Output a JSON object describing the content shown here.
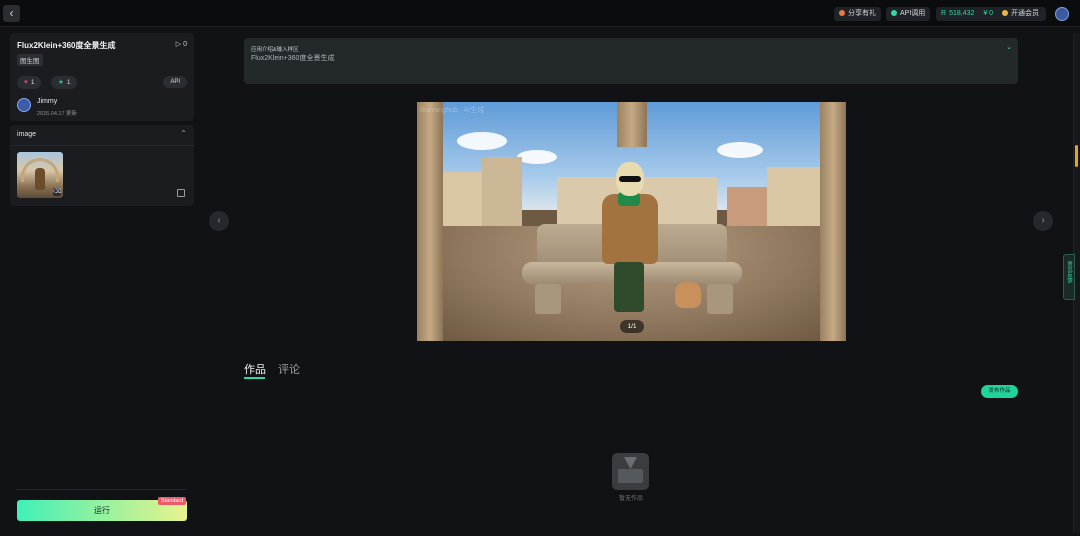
{
  "topbar": {
    "share_label": "分享有礼",
    "api_label": "API调用",
    "credits": "518,432",
    "balance": "¥ 0",
    "member_label": "开通会员"
  },
  "app": {
    "title": "Flux2Klein+360度全景生成",
    "play_count": "0",
    "tag": "图生图",
    "likes": "1",
    "favorites": "1",
    "api_button": "API",
    "author": "Jimmy",
    "updated": "2026.04.17 更新"
  },
  "inputs": {
    "image_label": "image"
  },
  "run": {
    "button_label": "运行",
    "badge": "Standard"
  },
  "intro": {
    "heading": "应用介绍&输入样区",
    "body": "Flux2Klein+360度全景生成"
  },
  "gallery": {
    "counter": "1/1",
    "watermark": "Runninghub · AI生成"
  },
  "tabs": {
    "works": "作品",
    "comments": "评论"
  },
  "works": {
    "publish_button": "发布作品",
    "empty_text": "暂无作品"
  },
  "side_tab": {
    "label": "意见反馈"
  },
  "colors": {
    "accent": "#2fd9a5",
    "background": "#111215",
    "panel": "#1a1c20",
    "badge_red": "#ef5a6b",
    "scroll_thumb": "#e0a52a"
  }
}
